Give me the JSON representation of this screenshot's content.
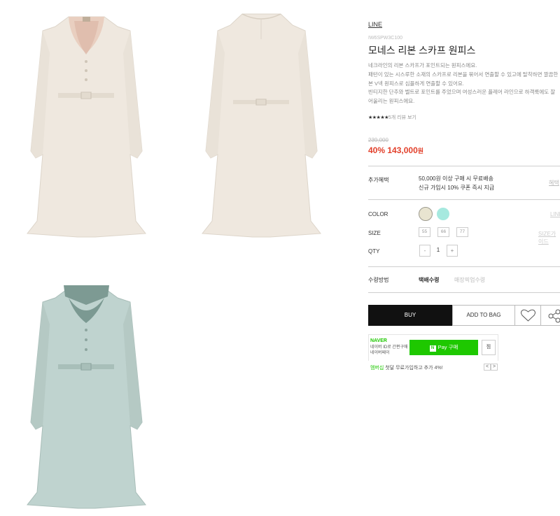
{
  "product": {
    "brand": "LINE",
    "code": "IW6SPW3C100",
    "title": "모네스 리본 스카프 원피스",
    "description": [
      "네크라인의 리본 스카프가 포인트되는 원피스에요.",
      "패턴이 있는 시스루한 소재의 스카프로 리본을 묶어서 연출할 수 있고에 탈착하면 깔끔한",
      "본 V넥 원피스로 심플하게 연출할 수 있어요.",
      "빈티지한 단추와 벨트로 포인트를 주었으며 여성스러운 플레어 라인으로 하객룩에도 잘",
      "어울리는 원피스에요."
    ],
    "rating_stars": "★★★★★",
    "rating_count": "5개 리뷰 보기",
    "original_price": "239,000",
    "discount": "40%",
    "sale_price": "143,000",
    "currency": "원"
  },
  "benefit": {
    "label": "추가혜택",
    "lines": [
      "50,000원 이상 구매 시 무료배송",
      "신규 가입시 10% 쿠폰 즉시 지급"
    ],
    "link": "혜택"
  },
  "options": {
    "color_label": "COLOR",
    "colors": [
      "#e8e4d0",
      "#a6e9df"
    ],
    "color_link": "LINE",
    "size_label": "SIZE",
    "sizes": [
      "55",
      "66",
      "77"
    ],
    "size_link": "SIZE가이드",
    "qty_label": "QTY",
    "qty_minus": "-",
    "qty_value": "1",
    "qty_plus": "+"
  },
  "shipping": {
    "label": "수령방법",
    "selected": "택배수령",
    "other": "매장픽업수령"
  },
  "actions": {
    "buy": "BUY",
    "add_to_bag": "ADD TO BAG"
  },
  "naver": {
    "logo": "NAVER",
    "sub_line1": "네이버 ID로 간편구매",
    "sub_line2": "네이버페이",
    "pay_badge": "N",
    "pay_label": "Pay 구매",
    "zzim": "찜",
    "foot_green": "멤버십",
    "foot_text": " 첫달 무료가입하고 추가 4%!",
    "prev": "<",
    "next": ">"
  },
  "colors": {
    "price_red": "#e2402b",
    "naver_green": "#1ec800",
    "buy_black": "#111111"
  }
}
